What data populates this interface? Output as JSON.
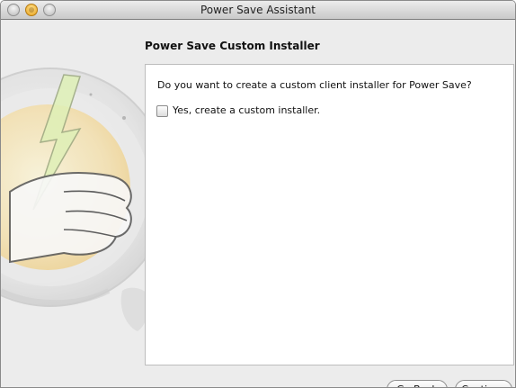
{
  "window": {
    "title": "Power Save Assistant"
  },
  "page": {
    "title": "Power Save Custom Installer",
    "question": "Do you want to create a custom client installer for Power Save?",
    "checkbox_label": "Yes, create a custom installer.",
    "checkbox_checked": false
  },
  "buttons": {
    "back_label": "Go Back",
    "continue_label": "Continue"
  },
  "icons": {
    "sidebar_art": "power-save-hand-lightning-icon"
  },
  "colors": {
    "title_bar_top": "#ececec",
    "title_bar_bottom": "#c9c9c9",
    "minimize_button": "#e7a21d",
    "panel_background": "#ffffff",
    "window_background": "#ececec"
  }
}
